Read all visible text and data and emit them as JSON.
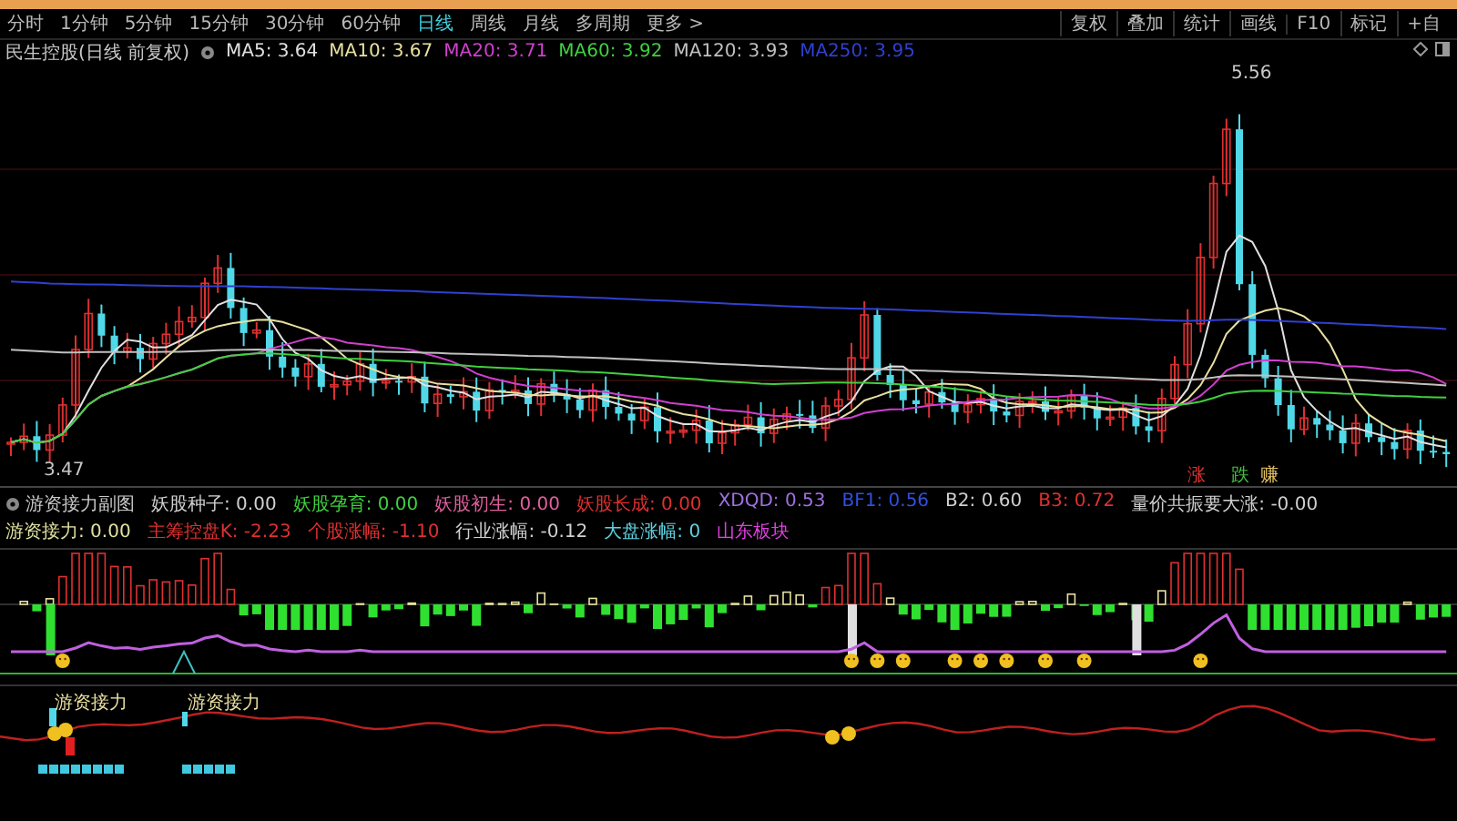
{
  "period_tabs": [
    {
      "label": "分时",
      "selected": false
    },
    {
      "label": "1分钟",
      "selected": false
    },
    {
      "label": "5分钟",
      "selected": false
    },
    {
      "label": "15分钟",
      "selected": false
    },
    {
      "label": "30分钟",
      "selected": false
    },
    {
      "label": "60分钟",
      "selected": false
    },
    {
      "label": "日线",
      "selected": true
    },
    {
      "label": "周线",
      "selected": false
    },
    {
      "label": "月线",
      "selected": false
    },
    {
      "label": "多周期",
      "selected": false
    },
    {
      "label": "更多 >",
      "selected": false
    }
  ],
  "toolbar_buttons": [
    "复权",
    "叠加",
    "统计",
    "画线",
    "F10",
    "标记",
    "+自"
  ],
  "main_chart": {
    "title": "民生控股(日线 前复权)",
    "ma_legend": [
      {
        "label": "MA5: 3.64",
        "color": "#e0e0e0"
      },
      {
        "label": "MA10: 3.67",
        "color": "#e8e0a0"
      },
      {
        "label": "MA20: 3.71",
        "color": "#d040d0"
      },
      {
        "label": "MA60: 3.92",
        "color": "#40d040"
      },
      {
        "label": "MA120: 3.93",
        "color": "#c0c0c0"
      },
      {
        "label": "MA250: 3.95",
        "color": "#3040d0"
      }
    ],
    "high_label": "5.56",
    "low_label": "3.47",
    "signal_labels": [
      {
        "text": "涨",
        "color": "#e03030"
      },
      {
        "text": "跌",
        "color": "#40c040"
      },
      {
        "text": "赚",
        "color": "#e0c060"
      }
    ]
  },
  "indicator_panel": {
    "title": "游资接力副图",
    "values": [
      {
        "text": "妖股种子: 0.00",
        "color": "#d0d0d0"
      },
      {
        "text": "妖股孕育: 0.00",
        "color": "#40d040"
      },
      {
        "text": "妖股初生: 0.00",
        "color": "#e060a0"
      },
      {
        "text": "妖股长成: 0.00",
        "color": "#e03030"
      },
      {
        "text": "XDQD: 0.53",
        "color": "#a070e0"
      },
      {
        "text": "BF1: 0.56",
        "color": "#3050e0"
      },
      {
        "text": "B2: 0.60",
        "color": "#d0d0d0"
      },
      {
        "text": "B3: 0.72",
        "color": "#e03030"
      },
      {
        "text": "量价共振要大涨: -0.00",
        "color": "#d0d0d0"
      },
      {
        "text": "游资接力: 0.00",
        "color": "#e0e0a0"
      },
      {
        "text": "主筹控盘K: -2.23",
        "color": "#e03030"
      },
      {
        "text": "个股涨幅: -1.10",
        "color": "#e03030"
      },
      {
        "text": "行业涨幅: -0.12",
        "color": "#d0d0d0"
      },
      {
        "text": "大盘涨幅: 0",
        "color": "#60d0e0"
      }
    ],
    "sector": "山东板块"
  },
  "lower_panel": {
    "labels": [
      "游资接力",
      "游资接力"
    ]
  }
}
